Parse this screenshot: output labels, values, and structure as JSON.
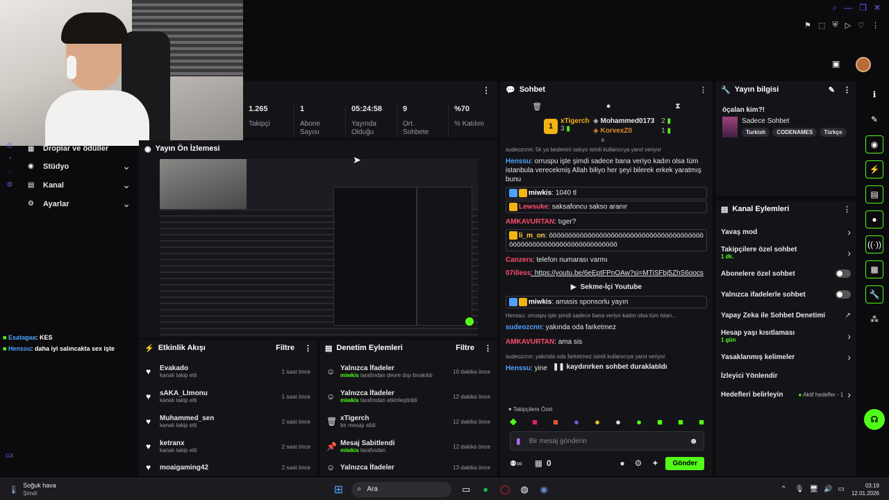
{
  "colors": {
    "accent": "#53fc18",
    "bg": "#0b0b0e",
    "panel": "#141418"
  },
  "stats": [
    {
      "value": "1.265",
      "label": "Takipçi"
    },
    {
      "value": "1",
      "label": "Abone Sayısı"
    },
    {
      "value": "05:24:58",
      "label": "Yayında Olduğu"
    },
    {
      "value": "9",
      "label": "Ort. Sohbete"
    },
    {
      "value": "%70",
      "label": "% Katılım"
    }
  ],
  "left_nav": [
    {
      "label": "Droplar ve ödüller",
      "icon": "gift-icon"
    },
    {
      "label": "Stüdyo",
      "icon": "studio-icon"
    },
    {
      "label": "Kanal",
      "icon": "channel-icon"
    },
    {
      "label": "Ayarlar",
      "icon": "gear-icon"
    }
  ],
  "overlay_chat": [
    {
      "user": "Esatagaa",
      "msg": ": KES"
    },
    {
      "user": "Henssu",
      "msg": ": daha iyi salıncakta sex işte"
    }
  ],
  "preview_title": "Yayın Ön İzlemesi",
  "activity": {
    "title": "Etkinlik Akışı",
    "filter": "Filtre",
    "items": [
      {
        "name": "Evakado",
        "sub": "kanalı takip etti",
        "time": "1 saat önce"
      },
      {
        "name": "sAKA_LImonu",
        "sub": "kanalı takip etti",
        "time": "1 saat önce"
      },
      {
        "name": "Muhammed_sen",
        "sub": "kanalı takip etti",
        "time": "2 saat önce"
      },
      {
        "name": "ketranx",
        "sub": "kanalı takip etti",
        "time": "2 saat önce"
      },
      {
        "name": "moaigaming42",
        "sub": "",
        "time": "2 saat önce"
      }
    ]
  },
  "moderation": {
    "title": "Denetim Eylemleri",
    "filter": "Filtre",
    "items": [
      {
        "name": "Yalnızca İfadeler",
        "user": "miwkis",
        "sub": " tarafından devre dışı bırakıldı",
        "time": "10 dakika önce"
      },
      {
        "name": "Yalnızca İfadeler",
        "user": "miwkis",
        "sub": " tarafından etkinleştirildi",
        "time": "12 dakika önce"
      },
      {
        "name": "xTigerch",
        "user": "",
        "sub": "bir mesajı sildi",
        "time": "12 dakika önce"
      },
      {
        "name": "Mesaj Sabitlendi",
        "user": "miwkis",
        "sub": " tarafından",
        "time": "12 dakika önce"
      },
      {
        "name": "Yalnızca İfadeler",
        "user": "",
        "sub": "",
        "time": "13 dakika önce"
      }
    ]
  },
  "chat": {
    "title": "Sohbet",
    "leaders": [
      {
        "rank": "1",
        "name": "xTigerch",
        "count": "3"
      },
      {
        "name": "Mohammed0173",
        "count": "2"
      },
      {
        "name": "KorvexZ0",
        "count": "1"
      }
    ],
    "reply_hint": "sudeozcnn: 5k ya bedenini satıyo isimli kullanıcıya yanıt veriyor",
    "lines": [
      {
        "user": "Henssu",
        "color": "#4ea1ff",
        "msg": ": orruspu işte şimdi sadece bana veriyo kadın olsa tüm istanbula verecekmiş Allah biliyo her şeyi bilerek erkek yaratmış bunu"
      },
      {
        "user": "miwkis",
        "color": "#ffffff",
        "msg": ": 1040 tl",
        "boxed": true
      },
      {
        "user": "Lewsuke",
        "color": "#ff4d6d",
        "msg": ": saksafoncu sakso aranır",
        "boxed": true
      },
      {
        "user": "AMKAVURTAN",
        "color": "#ff4d6d",
        "msg": ": tıger?"
      },
      {
        "user": "li_m_on",
        "color": "#ffd24d",
        "msg": ": öööööööööööööööööööööööööööööööööööööööööööööööööööööööööööööööööööö",
        "boxed": true
      },
      {
        "user": "Canzers",
        "color": "#ff4d6d",
        "msg": ": telefon numarası varmı"
      },
      {
        "user": "07illess",
        "color": "#ff4d6d",
        "msg": ": https://youtu.be/6eEptFPnOAw?si=MTiSFbj5ZhS6oocs"
      }
    ],
    "youtube_button": "Sekme-İçi Youtube",
    "lines2": [
      {
        "user": "miwkis",
        "color": "#ffffff",
        "msg": ": amasis sponsorlu yayın",
        "boxed": true
      }
    ],
    "reply_hint2": "Henssu: orruspu işte şimdi sadece bana veriyo kadın olsa tüm istan...",
    "lines3": [
      {
        "user": "sudeozcnn",
        "color": "#4ea1ff",
        "msg": ": yakında oda farketmez"
      },
      {
        "user": "AMKAVURTAN",
        "color": "#ff4d6d",
        "msg": ": ama sis"
      }
    ],
    "reply_hint3": "sudeozcnn: yakında oda farketmez isimli kullanıcıya yanıt veriyor",
    "lines4": [
      {
        "user": "Henssu",
        "color": "#4ea1ff",
        "msg": ": yine"
      }
    ],
    "paused": "kaydırırken sohbet duraklatıldı",
    "followers_only": "Takipçilere Özel",
    "input_placeholder": "Bir mesaj gönderin",
    "send": "Gönder",
    "points": "0"
  },
  "stream_info": {
    "title": "Yayın bilgisi",
    "stream_title": "öçalan kim?!",
    "category": "Sadece Sohbet",
    "tags": [
      "Turkish",
      "CODENAMES",
      "Türkçe"
    ]
  },
  "channel_actions": {
    "title": "Kanal Eylemleri",
    "items": [
      {
        "label": "Yavaş mod",
        "type": "chevron"
      },
      {
        "label": "Takipçilere özel sohbet",
        "sub": "1 dk.",
        "type": "chevron"
      },
      {
        "label": "Abonelere özel sohbet",
        "type": "toggle"
      },
      {
        "label": "Yalnızca ifadelerle sohbet",
        "type": "toggle"
      },
      {
        "label": "Yapay Zeka ile Sohbet Denetimi",
        "type": "external"
      },
      {
        "label": "Hesap yaşı kısıtlaması",
        "sub": "1 gün",
        "type": "chevron"
      },
      {
        "label": "Yasaklanmış kelimeler",
        "type": "chevron"
      },
      {
        "label": "İzleyici Yönlendir",
        "type": "none"
      },
      {
        "label": "Hedefleri belirleyin",
        "status": "Aktif hedefler - 1",
        "type": "chevron"
      }
    ]
  },
  "taskbar": {
    "weather_title": "Soğuk hava",
    "weather_sub": "Şimdi",
    "search": "Ara",
    "time": "03:19",
    "date": "12.01.2026"
  }
}
